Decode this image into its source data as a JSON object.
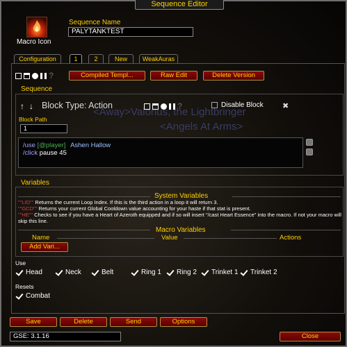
{
  "window": {
    "title": "Sequence Editor"
  },
  "macro": {
    "icon_label": "Macro Icon"
  },
  "sequence_name": {
    "label": "Sequence Name",
    "value": "PALYTANKTEST"
  },
  "tabs": [
    {
      "label": "Configuration"
    },
    {
      "label": "1"
    },
    {
      "label": "2"
    },
    {
      "label": "New"
    },
    {
      "label": "WeakAuras"
    }
  ],
  "toolbar": {
    "compiled_label": "Compiled Templ...",
    "raw_edit_label": "Raw Edit",
    "delete_version_label": "Delete Version"
  },
  "sequence": {
    "heading": "Sequence",
    "block_type": "Block Type: Action",
    "disable_block_label": "Disable Block",
    "close_glyph": "✖",
    "block_path_label": "Block Path",
    "block_path_value": "1",
    "background_line1": "<Away>Valorius, the Lightbringer",
    "background_line2": "<Angels At Arms>"
  },
  "code": {
    "line1_cmd": "/use",
    "line1_cond": "[@player]",
    "line1_spell": "Ashen Hallow",
    "line2_cmd": "/click",
    "line2_rest": "pause 45"
  },
  "variables": {
    "heading": "Variables",
    "system_heading": "System Variables",
    "lid_token": "\"\"LID\"\"",
    "lid_desc": "Returns the current Loop Index.  If this is the third action in a loop it will return 3.",
    "gcd_token": "\"\"GCD\"\"",
    "gcd_desc": "Returns your current Global Cooldown value accounting for your haste if that stat is present.",
    "he_token": "\"\"HE\"\"",
    "he_desc": "Checks to see if you have a Heart of Azeroth equipped and if so will insert \"/cast Heart Essence\" into the macro.  If not your macro will skip this line.",
    "macro_heading": "Macro Variables",
    "col_name": "Name",
    "col_value": "Value",
    "col_actions": "Actions",
    "add_label": "Add Vari..."
  },
  "use": {
    "heading": "Use",
    "items": [
      "Head",
      "Neck",
      "Belt",
      "Ring 1",
      "Ring 2",
      "Trinket 1",
      "Trinket 2"
    ]
  },
  "resets": {
    "heading": "Resets",
    "items": [
      "Combat"
    ]
  },
  "bottom": {
    "save_label": "Save",
    "delete_label": "Delete",
    "send_label": "Send",
    "options_label": "Options",
    "close_label": "Close",
    "status": "GSE: 3.1.16"
  },
  "colors": {
    "gold": "#ffd100",
    "button_red": "#7a0000",
    "code_command": "#a0a0ff",
    "code_condition": "#4caf50",
    "variable_token": "#d04040"
  },
  "icons": [
    "macro-fire-icon",
    "arrow-up-icon",
    "arrow-down-icon",
    "square-icon",
    "stack-icon",
    "circle-icon",
    "pause-icon",
    "help-icon",
    "close-icon"
  ]
}
